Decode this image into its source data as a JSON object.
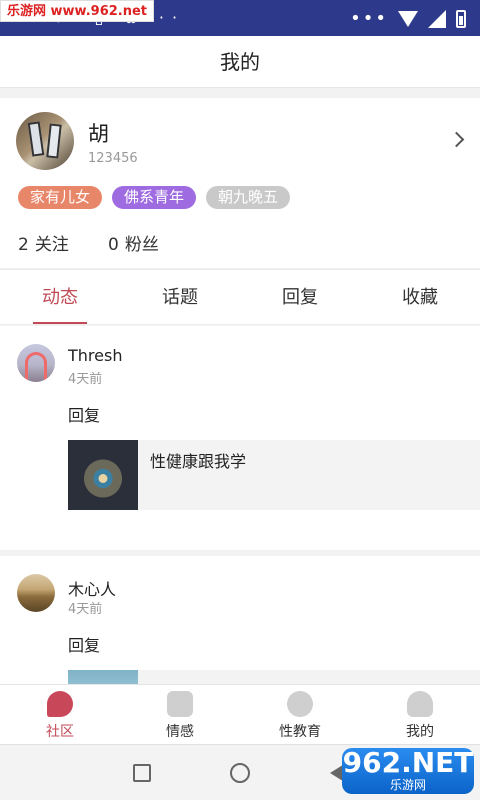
{
  "status_bar": {
    "time": "1:40",
    "watermark": "乐游网 www.962.net"
  },
  "header": {
    "title": "我的"
  },
  "profile": {
    "name": "胡",
    "id": "123456",
    "tags": [
      "家有儿女",
      "佛系青年",
      "朝九晚五"
    ],
    "following_count": "2",
    "following_label": "关注",
    "fans_count": "0",
    "fans_label": "粉丝"
  },
  "tabs": [
    {
      "label": "动态",
      "active": true
    },
    {
      "label": "话题",
      "active": false
    },
    {
      "label": "回复",
      "active": false
    },
    {
      "label": "收藏",
      "active": false
    }
  ],
  "feed": [
    {
      "user": "Thresh",
      "time": "4天前",
      "text": "回复",
      "card_title": "性健康跟我学"
    },
    {
      "user": "木心人",
      "time": "4天前",
      "text": "回复",
      "card_title": ""
    }
  ],
  "bottom_nav": [
    {
      "label": "社区",
      "icon": "community-icon",
      "active": true
    },
    {
      "label": "情感",
      "icon": "heart-pulse-icon",
      "active": false
    },
    {
      "label": "性教育",
      "icon": "education-icon",
      "active": false
    },
    {
      "label": "我的",
      "icon": "person-icon",
      "active": false
    }
  ],
  "watermark_bottom": {
    "main": "962.NET",
    "sub": "乐游网"
  },
  "colors": {
    "accent": "#c04a55",
    "status_bar": "#2d3a8c"
  }
}
